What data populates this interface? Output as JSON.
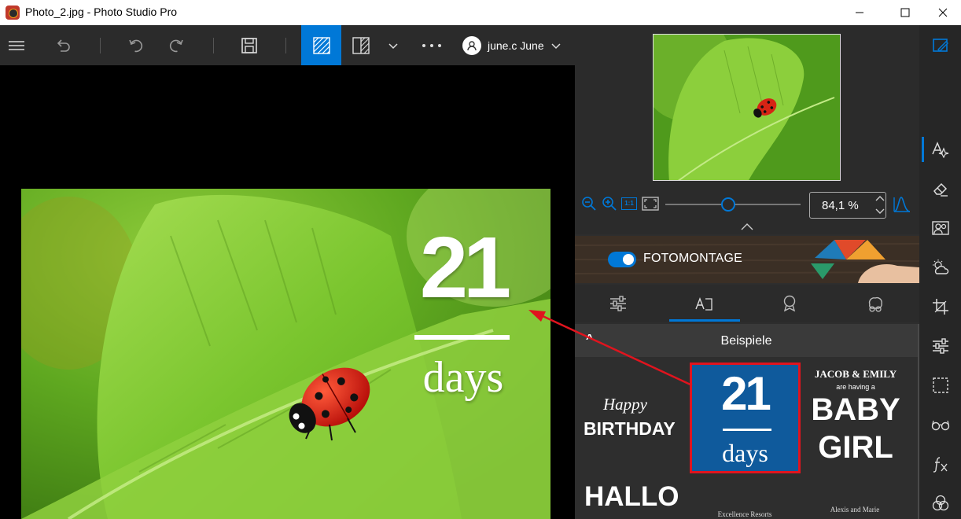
{
  "window": {
    "title": "Photo_2.jpg - Photo Studio Pro"
  },
  "toolbar": {
    "user_name": "june.c June"
  },
  "canvas_overlay": {
    "number": "21",
    "word": "days"
  },
  "zoom": {
    "value": "84,1 %",
    "actual_size_label": "1:1",
    "slider_percent": 40
  },
  "fotomontage": {
    "label": "FOTOMONTAGE",
    "enabled": true
  },
  "samples_section": {
    "collapse_glyph": "^",
    "title": "Beispiele"
  },
  "samples": {
    "happy": "Happy",
    "birthday": "BIRTHDAY",
    "days_number": "21",
    "days_word": "days",
    "names": "JACOB & EMILY",
    "having": "are having a",
    "baby": "BABY",
    "girl": "GIRL",
    "hallo": "HALLO",
    "resorts": "Excellence Resorts",
    "alexis": "Alexis and Marie"
  },
  "colors": {
    "accent": "#0078d7",
    "annotation": "#e0141e",
    "sample_blue": "#0f5a9c"
  }
}
